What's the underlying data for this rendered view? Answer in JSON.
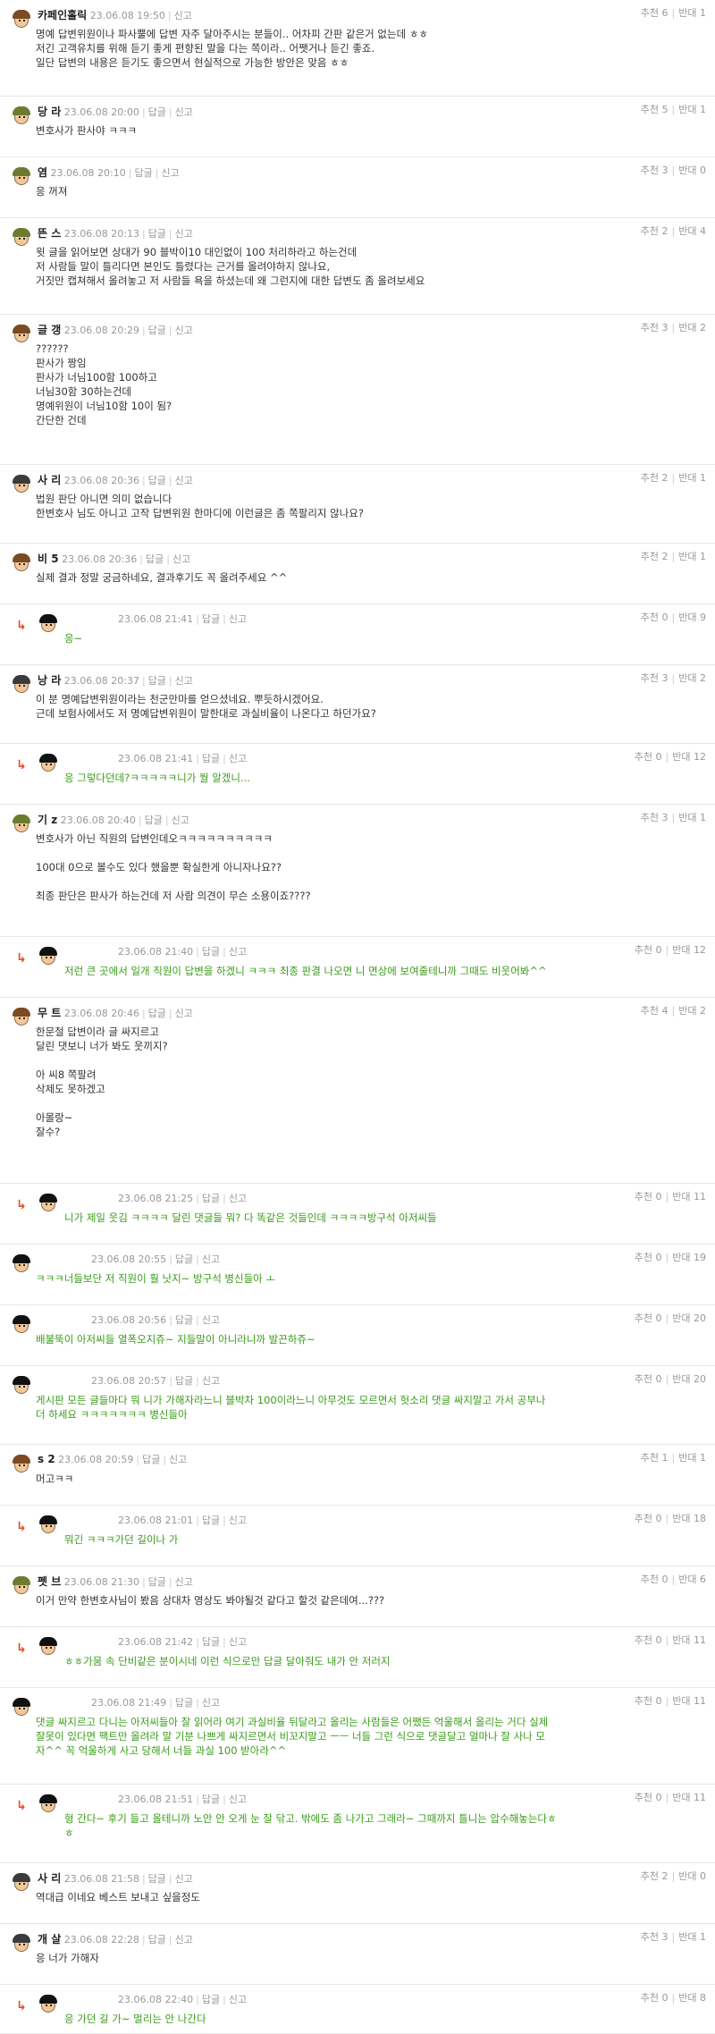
{
  "comments": [
    {
      "nick": "카페인홀릭",
      "date": "23.06.08 19:50",
      "reply": "",
      "report": "신고",
      "up": "추천 6",
      "down": "반대 1",
      "cap": "brown",
      "lines": [
        "명예 답변위원이나 파사뿔에 답변 자주 달아주시는 분들이.. 어차피 간판 같은거 없는데 ㅎㅎ",
        "저긴 고객유치를 위해 듣기 좋게 편향된 말을 다는 쪽이라.. 어쨋거나 듣긴 좋죠.",
        "일단 답변의 내용은 듣기도 좋으면서 현실적으로 가능한 방안은 맞음 ㅎㅎ"
      ]
    },
    {
      "nick": "당                    라",
      "date": "23.06.08 20:00",
      "reply": "답글",
      "report": "신고",
      "up": "추천 5",
      "down": "반대 1",
      "cap": "olive",
      "lines": [
        "변호사가 판사야 ㅋㅋㅋ"
      ]
    },
    {
      "nick": "염",
      "date": "23.06.08 20:10",
      "reply": "답글",
      "report": "신고",
      "up": "추천 3",
      "down": "반대 0",
      "cap": "olive",
      "lines": [
        "응 꺼져"
      ]
    },
    {
      "nick": "뜬          스",
      "date": "23.06.08 20:13",
      "reply": "답글",
      "report": "신고",
      "up": "추천 2",
      "down": "반대 4",
      "cap": "olive",
      "lines": [
        "윗 글을 읽어보면 상대가 90 블박이10 대인없이 100 처리하라고 하는건데",
        "저 사람들 말이 틀리다면 본인도 틀렸다는 근거를 올려야하지 않나요,",
        "거짓만 캡쳐해서 올려놓고 저 사람들 욕을 하셨는데 왜 그런지에 대한 답변도 좀 올려보세요"
      ]
    },
    {
      "nick": "글          갱",
      "date": "23.06.08 20:29",
      "reply": "답글",
      "report": "신고",
      "up": "추천 3",
      "down": "반대 2",
      "cap": "brown",
      "lines": [
        "??????",
        "판사가 짱임",
        "판사가 너님100함 100하고",
        "너님30함 30하는건데",
        "명예위원이 너님10함 10이 됨?",
        "간단한 건데"
      ]
    },
    {
      "nick": "사    리",
      "date": "23.06.08 20:36",
      "reply": "답글",
      "report": "신고",
      "up": "추천 2",
      "down": "반대 1",
      "cap": "dark",
      "lines": [
        "법원 판단 아니면 의미 없습니다",
        "한변호사 님도 아니고 고작 답변위원 한마디에 이런글은 좀 쪽팔리지 않나요?"
      ]
    },
    {
      "nick": "비                  5",
      "date": "23.06.08 20:36",
      "reply": "답글",
      "report": "신고",
      "up": "추천 2",
      "down": "반대 1",
      "cap": "brown",
      "lines": [
        "실제 결과 정말 궁금하네요, 결과후기도 꼭 올려주세요 ^^"
      ]
    },
    {
      "nick": "",
      "date": "23.06.08 21:41",
      "reply": "답글",
      "report": "신고",
      "up": "추천 0",
      "down": "반대 9",
      "cap": "black",
      "reply_row": true,
      "green": true,
      "lines": [
        "응~"
      ]
    },
    {
      "nick": "낭          라",
      "date": "23.06.08 20:37",
      "reply": "답글",
      "report": "신고",
      "up": "추천 3",
      "down": "반대 2",
      "cap": "dark",
      "lines": [
        "이 분 명예답변위원이라는 천군만마를 얻으셨네요. 뿌듯하시겠어요.",
        "근데 보험사에서도 저 명예답변위원이 말한대로 과실비율이 나온다고 하던가요?"
      ]
    },
    {
      "nick": "",
      "date": "23.06.08 21:41",
      "reply": "답글",
      "report": "신고",
      "up": "추천 0",
      "down": "반대 12",
      "cap": "black",
      "reply_row": true,
      "green": true,
      "lines": [
        "응 그렇다던데?ㅋㅋㅋㅋㅋ니가 뭘 알겠니..."
      ]
    },
    {
      "nick": "기           z",
      "date": "23.06.08 20:40",
      "reply": "답글",
      "report": "신고",
      "up": "추천 3",
      "down": "반대 1",
      "cap": "olive",
      "lines": [
        "변호사가 아닌 직원의 답변인데오ㅋㅋㅋㅋㅋㅋㅋㅋㅋㅋ",
        "",
        "100대 0으로 볼수도 있다 했을뿐 확실한게 아니자나요??",
        "",
        "최종 판단은 판사가 하는건데 저 사람 의견이 무슨 소용이죠????"
      ]
    },
    {
      "nick": "",
      "date": "23.06.08 21:40",
      "reply": "답글",
      "report": "신고",
      "up": "추천 0",
      "down": "반대 12",
      "cap": "black",
      "reply_row": true,
      "green": true,
      "lines": [
        "저런 큰 곳에서 일개 직원이 답변을 하겠니 ㅋㅋㅋ 최종 판결 나오면 니 면상에 보여줄테니까 그때도 비웃어봐^^"
      ]
    },
    {
      "nick": "무                  트",
      "date": "23.06.08 20:46",
      "reply": "답글",
      "report": "신고",
      "up": "추천 4",
      "down": "반대 2",
      "cap": "brown",
      "lines": [
        "한문철 답변이라 글 싸지르고",
        "달린 댓보니 너가 봐도 웃끼지?",
        "",
        "아 씨8 쪽팔려",
        "삭제도 못하겠고",
        "",
        "아몰랑~",
        "잘수?"
      ]
    },
    {
      "nick": "",
      "date": "23.06.08 21:25",
      "reply": "답글",
      "report": "신고",
      "up": "추천 0",
      "down": "반대 11",
      "cap": "black",
      "reply_row": true,
      "green": true,
      "lines": [
        "니가 제일 웃김 ㅋㅋㅋㅋ 달린 댓글들 뭐? 다 똑같은 것들인데 ㅋㅋㅋㅋ방구석 아저씨들"
      ]
    },
    {
      "nick": "",
      "date": "23.06.08 20:55",
      "reply": "답글",
      "report": "신고",
      "up": "추천 0",
      "down": "반대 19",
      "cap": "black",
      "green": true,
      "lines": [
        "ㅋㅋㅋ너들보단 저 직원이 훨 낫지~ 방구석 병신들아 ㅗ"
      ]
    },
    {
      "nick": "",
      "date": "23.06.08 20:56",
      "reply": "답글",
      "report": "신고",
      "up": "추천 0",
      "down": "반대 20",
      "cap": "black",
      "green": true,
      "lines": [
        "배불뚝이 아저씨들 열폭오지쥬~ 지들말이 아니라니까 발끈하쥬~"
      ]
    },
    {
      "nick": "",
      "date": "23.06.08 20:57",
      "reply": "답글",
      "report": "신고",
      "up": "추천 0",
      "down": "반대 20",
      "cap": "black",
      "green": true,
      "lines": [
        "게시판 모든 글들마다 뭐 니가 가해자라느니 블박차 100이라느니 아무것도 모르면서 헛소리 댓글 싸지말고 가서 공부나",
        "더 하세요 ㅋㅋㅋㅋㅋㅋㅋ 병신들아"
      ]
    },
    {
      "nick": "s      2",
      "date": "23.06.08 20:59",
      "reply": "답글",
      "report": "신고",
      "up": "추천 1",
      "down": "반대 1",
      "cap": "brown",
      "lines": [
        "머고ㅋㅋ"
      ]
    },
    {
      "nick": "",
      "date": "23.06.08 21:01",
      "reply": "답글",
      "report": "신고",
      "up": "추천 0",
      "down": "반대 18",
      "cap": "black",
      "reply_row": true,
      "green": true,
      "lines": [
        "뭐긴 ㅋㅋㅋ가던 길이나 가"
      ]
    },
    {
      "nick": "펫    브",
      "date": "23.06.08 21:30",
      "reply": "답글",
      "report": "신고",
      "up": "추천 0",
      "down": "반대 6",
      "cap": "olive",
      "lines": [
        "이거 만약 한변호사님이 봤음 상대차 영상도 봐야될것 같다고 할것 같은데여...???"
      ]
    },
    {
      "nick": "",
      "date": "23.06.08 21:42",
      "reply": "답글",
      "report": "신고",
      "up": "추천 0",
      "down": "반대 11",
      "cap": "black",
      "reply_row": true,
      "green": true,
      "lines": [
        "ㅎㅎ가뭄 속 단비같은 분이시네 이런 식으로만 답글 달아줘도 내가 안 저러지"
      ]
    },
    {
      "nick": "",
      "date": "23.06.08 21:49",
      "reply": "답글",
      "report": "신고",
      "up": "추천 0",
      "down": "반대 11",
      "cap": "black",
      "green": true,
      "lines": [
        "댓글 싸지르고 다니는 아저씨들아 잘 읽어라 여기 과실비율 뒤달라고 올리는 사람들은 어쨌든 억울해서 올리는 거다 실제",
        "잘못이 있다면 팩트만 올려라 말 기분 나쁘게 싸지르면서 비꼬지말고 ㅡㅡ 너들 그런 식으로 댓글달고 얼마나 잘 사나 모",
        "자^^ 꼭 억울하게 사고 당해서 너들 과실 100 받아라^^"
      ]
    },
    {
      "nick": "",
      "date": "23.06.08 21:51",
      "reply": "답글",
      "report": "신고",
      "up": "추천 0",
      "down": "반대 11",
      "cap": "black",
      "reply_row": true,
      "green": true,
      "lines": [
        "형 간다~ 후기 들고 올테니까 노안 안 오게 눈 잘 닦고. 밖에도 좀 나가고 그래라~ 그때까지 틀니는 압수해놓는다ㅎ",
        "ㅎ"
      ]
    },
    {
      "nick": "사    리",
      "date": "23.06.08 21:58",
      "reply": "답글",
      "report": "신고",
      "up": "추천 2",
      "down": "반대 0",
      "cap": "dark",
      "lines": [
        "역대급 이네요 베스트 보내고 싶을정도"
      ]
    },
    {
      "nick": "개          살",
      "date": "23.06.08 22:28",
      "reply": "답글",
      "report": "신고",
      "up": "추천 3",
      "down": "반대 1",
      "cap": "dark",
      "lines": [
        "응 너가 가해자"
      ]
    },
    {
      "nick": "",
      "date": "23.06.08 22:40",
      "reply": "답글",
      "report": "신고",
      "up": "추천 0",
      "down": "반대 8",
      "cap": "black",
      "reply_row": true,
      "green": true,
      "lines": [
        "응 가던 길 가~ 멀리는 안 나간다"
      ]
    }
  ]
}
